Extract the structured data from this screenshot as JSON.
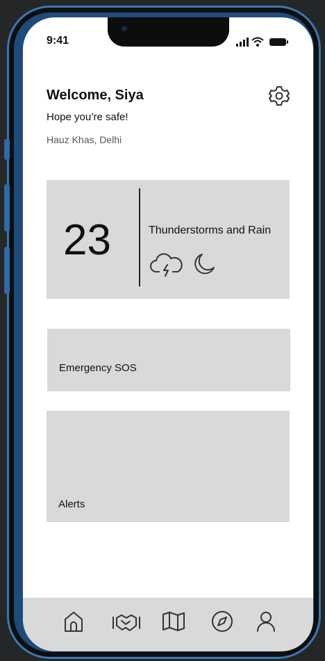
{
  "status_bar": {
    "time": "9:41"
  },
  "header": {
    "greeting": "Welcome, Siya",
    "subtitle": "Hope you’re safe!",
    "location": "Hauz Khas, Delhi",
    "settings_icon": "gear-icon"
  },
  "weather": {
    "temperature": "23",
    "condition": "Thunderstorms and Rain",
    "icons": [
      "thunderstorm-cloud-icon",
      "moon-icon"
    ]
  },
  "sos": {
    "label": "Emergency SOS"
  },
  "alerts": {
    "label": "Alerts"
  },
  "bottom_nav": {
    "items": [
      {
        "icon": "home-icon"
      },
      {
        "icon": "handshake-icon"
      },
      {
        "icon": "map-icon"
      },
      {
        "icon": "compass-icon"
      },
      {
        "icon": "profile-icon"
      }
    ]
  },
  "colors": {
    "background": "#252628",
    "frame": "#1d4c7a",
    "card": "#d9d9d9",
    "screen": "#ffffff"
  }
}
